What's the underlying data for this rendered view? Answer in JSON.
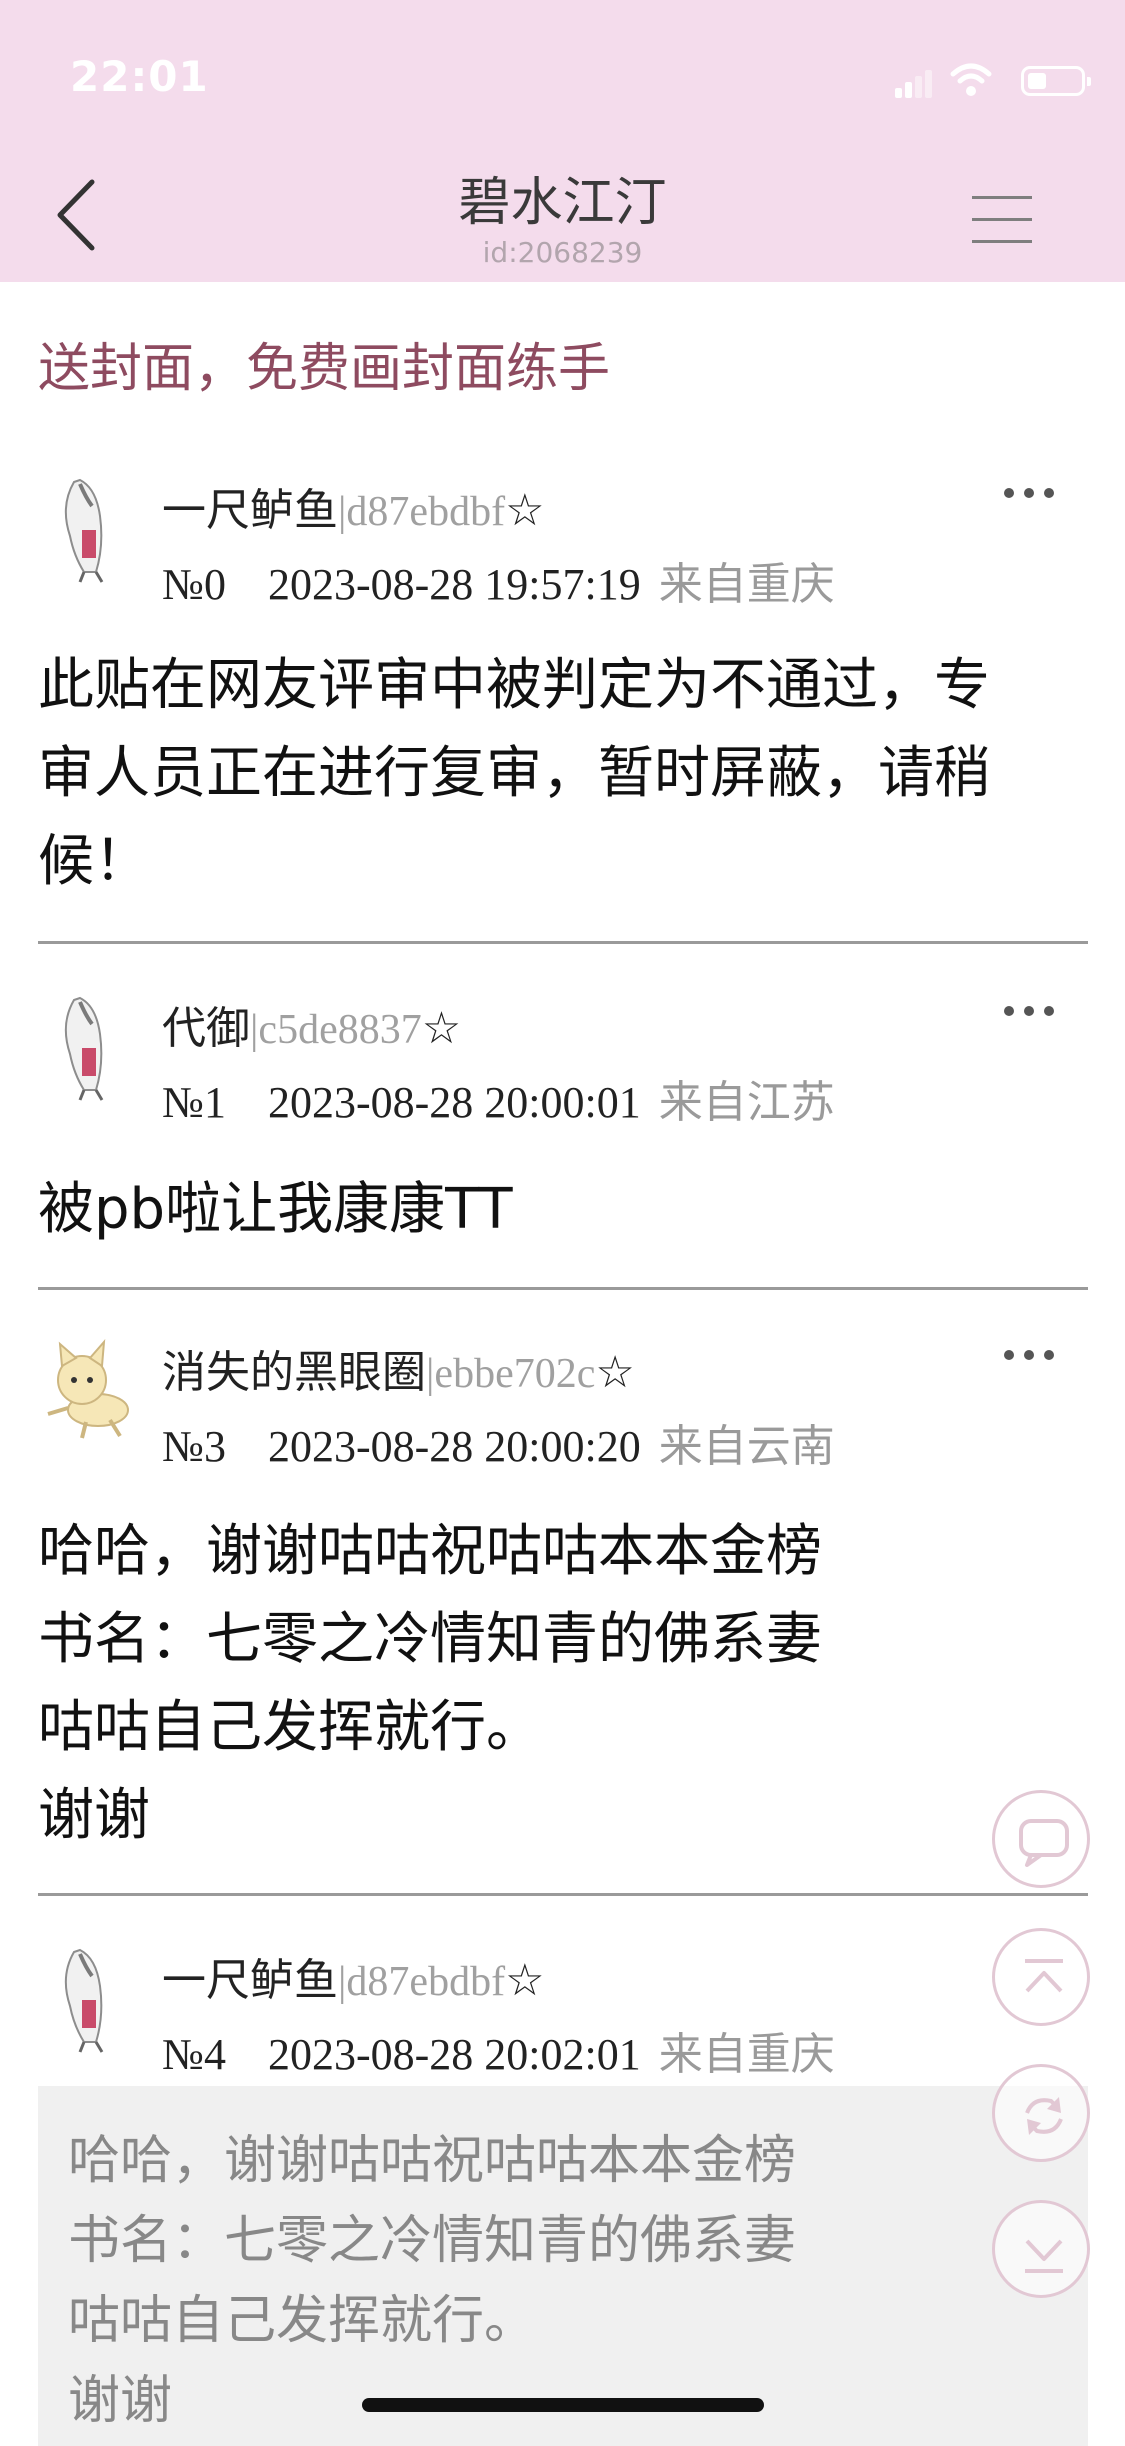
{
  "status_bar": {
    "time": "22:01"
  },
  "nav": {
    "title": "碧水江汀",
    "subtitle": "id:2068239"
  },
  "thread_title": "送封面，免费画封面练手",
  "posts": [
    {
      "username": "一尺鲈鱼",
      "uid": "d87ebdbf",
      "star": "☆",
      "floor": "№0",
      "datetime": "2023-08-28 19:57:19",
      "location": "来自重庆",
      "avatar": "lanky-figure-avatar",
      "body": [
        "此贴在网友评审中被判定为不通过，专",
        "审人员正在进行复审，暂时屏蔽，请稍",
        "候！"
      ]
    },
    {
      "username": "代御",
      "uid": "c5de8837",
      "star": "☆",
      "floor": "№1",
      "datetime": "2023-08-28 20:00:01",
      "location": "来自江苏",
      "avatar": "lanky-figure-avatar",
      "body": [
        "被pb啦让我康康TT"
      ]
    },
    {
      "username": "消失的黑眼圈",
      "uid": "ebbe702c",
      "star": "☆",
      "floor": "№3",
      "datetime": "2023-08-28 20:00:20",
      "location": "来自云南",
      "avatar": "cat-avatar",
      "body": [
        "哈哈，谢谢咕咕祝咕咕本本金榜",
        "书名：七零之冷情知青的佛系妻",
        "咕咕自己发挥就行。",
        "谢谢"
      ]
    },
    {
      "username": "一尺鲈鱼",
      "uid": "d87ebdbf",
      "star": "☆",
      "floor": "№4",
      "datetime": "2023-08-28 20:02:01",
      "location": "来自重庆",
      "avatar": "lanky-figure-avatar",
      "quote": [
        "哈哈，谢谢咕咕祝咕咕本本金榜",
        "书名：七零之冷情知青的佛系妻",
        "咕咕自己发挥就行。",
        "谢谢"
      ]
    }
  ],
  "floating_buttons": [
    "comment-icon",
    "scroll-top-icon",
    "refresh-icon",
    "scroll-bottom-icon"
  ],
  "colors": {
    "header_bg": "#f4dcec",
    "thread_title": "#8e4b60",
    "uid": "#a0a0a0",
    "location": "#9a9a9a",
    "quote_bg": "#f0f0f0"
  }
}
